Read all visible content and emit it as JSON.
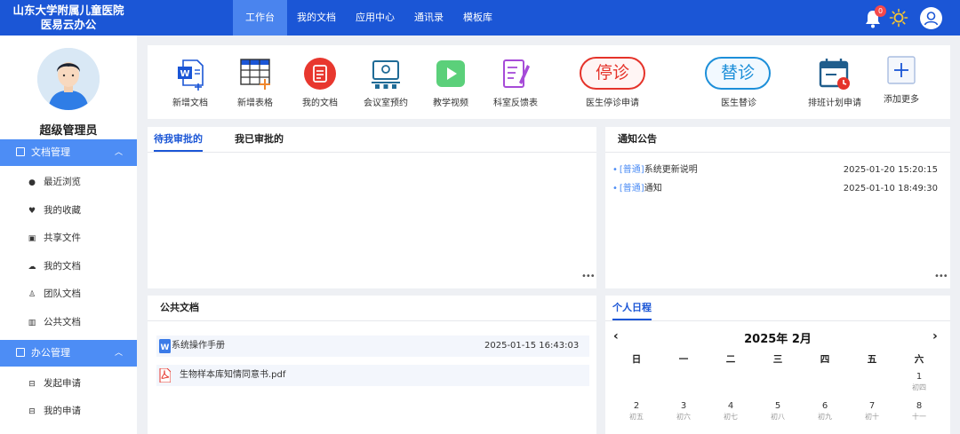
{
  "header": {
    "logo_line1": "山东大学附属儿童医院",
    "logo_line2": "医易云办公",
    "nav": [
      "工作台",
      "我的文档",
      "应用中心",
      "通讯录",
      "模板库"
    ],
    "notification_count": "0",
    "brand_color": "#1b56d6"
  },
  "sidebar": {
    "user_name": "超级管理员",
    "groups": [
      {
        "label": "文档管理",
        "icon": "document-icon",
        "items": [
          {
            "label": "最近浏览",
            "icon": "clock-icon"
          },
          {
            "label": "我的收藏",
            "icon": "heart-icon"
          },
          {
            "label": "共享文件",
            "icon": "share-file-icon"
          },
          {
            "label": "我的文档",
            "icon": "cloud-doc-icon"
          },
          {
            "label": "团队文档",
            "icon": "team-icon"
          },
          {
            "label": "公共文档",
            "icon": "book-icon"
          }
        ]
      },
      {
        "label": "办公管理",
        "icon": "office-icon",
        "items": [
          {
            "label": "发起申请",
            "icon": "apply-icon"
          },
          {
            "label": "我的申请",
            "icon": "my-apply-icon"
          }
        ]
      }
    ]
  },
  "shortcuts": [
    {
      "label": "新增文档",
      "icon": "word-doc-icon"
    },
    {
      "label": "新增表格",
      "icon": "table-icon"
    },
    {
      "label": "我的文档",
      "icon": "my-doc-icon"
    },
    {
      "label": "会议室预约",
      "icon": "meeting-room-icon"
    },
    {
      "label": "教学视频",
      "icon": "video-icon"
    },
    {
      "label": "科室反馈表",
      "icon": "feedback-form-icon"
    },
    {
      "label": "医生停诊申请",
      "icon": "stop-clinic-icon",
      "badge": "停诊"
    },
    {
      "label": "医生替诊",
      "icon": "substitute-clinic-icon",
      "badge": "替诊"
    },
    {
      "label": "排班计划申请",
      "icon": "schedule-calendar-icon"
    },
    {
      "label": "添加更多",
      "icon": "plus-icon"
    }
  ],
  "approvals": {
    "tabs": [
      "待我审批的",
      "我已审批的"
    ],
    "active_tab": 0
  },
  "notices": {
    "title": "通知公告",
    "items": [
      {
        "tag": "[普通]",
        "text": "系统更新说明",
        "time": "2025-01-20 15:20:15"
      },
      {
        "tag": "[普通]",
        "text": "通知",
        "time": "2025-01-10 18:49:30"
      }
    ]
  },
  "public_docs": {
    "title": "公共文档",
    "items": [
      {
        "name": "系统操作手册",
        "time": "2025-01-15 16:43:03",
        "type": "word"
      },
      {
        "name": "生物样本库知情同意书.pdf",
        "time": "",
        "type": "pdf"
      }
    ]
  },
  "schedule": {
    "title": "个人日程",
    "month_label": "2025年 2月",
    "prev": "‹",
    "next": "›",
    "weekdays": [
      "日",
      "一",
      "二",
      "三",
      "四",
      "五",
      "六"
    ],
    "days": [
      {
        "day": "1",
        "lunar": "初四",
        "col": 6,
        "row": 0
      },
      {
        "day": "2",
        "lunar": "初五",
        "col": 0,
        "row": 1
      },
      {
        "day": "3",
        "lunar": "初六",
        "col": 1,
        "row": 1
      },
      {
        "day": "4",
        "lunar": "初七",
        "col": 2,
        "row": 1
      },
      {
        "day": "5",
        "lunar": "初八",
        "col": 3,
        "row": 1
      },
      {
        "day": "6",
        "lunar": "初九",
        "col": 4,
        "row": 1
      },
      {
        "day": "7",
        "lunar": "初十",
        "col": 5,
        "row": 1
      },
      {
        "day": "8",
        "lunar": "十一",
        "col": 6,
        "row": 1
      }
    ]
  }
}
